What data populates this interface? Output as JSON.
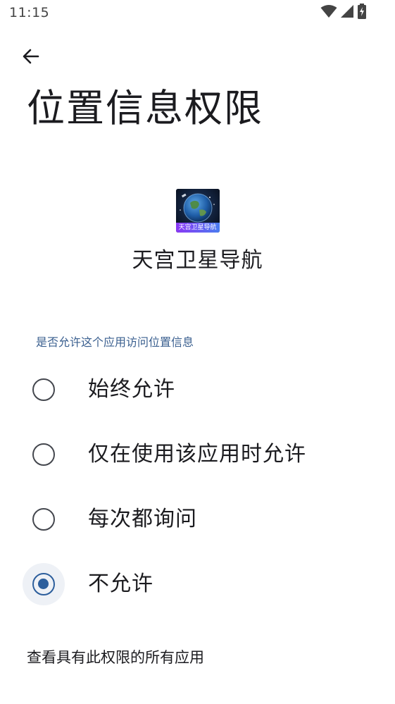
{
  "status_bar": {
    "time": "11:15",
    "icons": [
      "wifi-icon",
      "cellular-signal-icon",
      "battery-charging-icon"
    ]
  },
  "header": {
    "back_icon": "arrow-back-icon",
    "title": "位置信息权限"
  },
  "app": {
    "icon_caption": "天宫卫星导航",
    "name": "天宫卫星导航"
  },
  "permission": {
    "section_label": "是否允许这个应用访问位置信息",
    "options": [
      {
        "label": "始终允许",
        "selected": false
      },
      {
        "label": "仅在使用该应用时允许",
        "selected": false
      },
      {
        "label": "每次都询问",
        "selected": false
      },
      {
        "label": "不允许",
        "selected": true
      }
    ]
  },
  "footer": {
    "view_all_label": "查看具有此权限的所有应用"
  },
  "colors": {
    "accent": "#2c5e9c",
    "section_label": "#3a5f8f",
    "text": "#1b1b1f",
    "radio_border": "#44474e"
  }
}
